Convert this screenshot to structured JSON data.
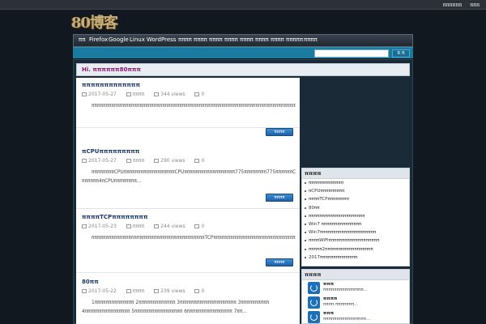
{
  "topbar": {
    "links": [
      "ππππππ",
      "πππ"
    ]
  },
  "logo": {
    "text": "80博客"
  },
  "nav": {
    "items": [
      "ππ",
      "Firefox",
      "Google",
      "Linux",
      "WordPress",
      "ππππ",
      "ππππ",
      "ππππ",
      "ππππ",
      "ππππ",
      "ππππ",
      "ππππ",
      "πππππ",
      "ππππ"
    ]
  },
  "search": {
    "value": "",
    "button": "π π"
  },
  "hi": {
    "text": "Hi.  ππππππ80πππ"
  },
  "posts": [
    {
      "title": "πππππππππππππ",
      "date": "2017-05-27",
      "category": "ππππ",
      "views": "344 views",
      "comments": "0",
      "excerpt": "ππππππππππππππππππππππππππππππππππππππππππππππππππππππππππππππππππππππππππππππππππππππππππππππππππππππππππππππππππππππππππππππππππππππππππππππππππππ80πππππππ...",
      "more": "ππππ"
    },
    {
      "title": "πCPUπππππππππ",
      "date": "2017-05-27",
      "category": "ππππ",
      "views": "290 views",
      "comments": "0",
      "excerpt": "ππππππππCPUππππππππππππππππππCPUππππππππππππππππππ775ππππππππ775ππππππCPUππE3300πQ9550ππππππππππππππππCPUππππ     ππππππ4πCPUππππππππ...",
      "more": "ππππ"
    },
    {
      "title": "ππππTCPππππππππ",
      "date": "2017-05-23",
      "category": "ππππ",
      "views": "244 views",
      "comments": "0",
      "excerpt": "ππππππππππππππππππππππππππππππππππππππππTCPπππππππππππππππππππππππππππππππππππππππππππππππππππππππππππππππππππππππππππππππππ...",
      "more": "ππππ"
    },
    {
      "title": "80ππ",
      "date": "2017-05-22",
      "category": "ππππ",
      "views": "239 views",
      "comments": "0",
      "excerpt": "1ππππππππππππππ 2πππππππππππππ 3ππππππππππππππππππππ 3ππππππππππ 4ππππππππππππππππ 5πππππππππππππππππ 6ππππππππππππππππ 7ππ...",
      "more": ""
    }
  ],
  "widgets": {
    "recent_title": "ππππ",
    "recent": [
      "πππππππππππππ",
      "πCPUπππππππππ",
      "ππππTCPππππππππ",
      "80ππ",
      "πππππππππππππππππππππ",
      "Win7 πππππππππππππππ",
      "Win7πππππππππππππππππππππ",
      "ππππWiFiπππππππππππππππππππ",
      "πππππ2ππππππππππππππππππ",
      "2017ππππππππππππππ"
    ],
    "comments_title": "ππππ",
    "comments": [
      {
        "name": "πππ",
        "text": "πππππππππππππππ..."
      },
      {
        "name": "ππππ",
        "text": "ππππ πππππππ..."
      },
      {
        "name": "πππ",
        "text": "ππππππππππππππππ..."
      }
    ]
  }
}
